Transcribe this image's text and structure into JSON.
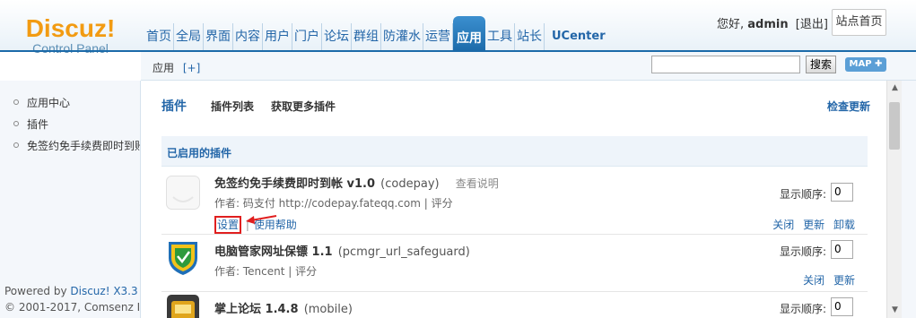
{
  "logo": {
    "main": "Discuz!",
    "sub": "Control Panel"
  },
  "nav": {
    "items": [
      "首页",
      "全局",
      "界面",
      "内容",
      "用户",
      "门户",
      "论坛",
      "群组",
      "防灌水",
      "运营",
      "应用",
      "工具",
      "站长",
      "UCenter"
    ],
    "active": "应用"
  },
  "user": {
    "greeting": "您好,",
    "name": "admin",
    "logout": "[退出]",
    "home_button": "站点首页"
  },
  "subbar": {
    "breadcrumb": "应用",
    "add": "[+]",
    "search_button": "搜索",
    "map_button": "MAP ✚"
  },
  "sidebar": {
    "items": [
      "应用中心",
      "插件",
      "免签约免手续费即时到账"
    ],
    "footer_powered": "Powered by ",
    "footer_link": "Discuz! X3.3",
    "footer_copyright": "© 2001-2017, Comsenz Inc."
  },
  "main": {
    "title": "插件",
    "tabs": [
      "插件列表",
      "获取更多插件"
    ],
    "check_update": "检查更新",
    "section_title": "已启用的插件",
    "order_label": "显示顺序:",
    "plugins": [
      {
        "name": "免签约免手续费即时到帐 v1.0",
        "identifier": "(codepay)",
        "view_doc": "查看说明",
        "meta": "作者: 码支付 http://codepay.fateqq.com | 评分",
        "settings": "设置",
        "help": "使用帮助",
        "order": "0",
        "actions": [
          "关闭",
          "更新",
          "卸载"
        ]
      },
      {
        "name": "电脑管家网址保镖 1.1",
        "identifier": "(pcmgr_url_safeguard)",
        "meta": "作者: Tencent | 评分",
        "order": "0",
        "actions": [
          "关闭",
          "更新"
        ]
      },
      {
        "name": "掌上论坛 1.4.8",
        "identifier": "(mobile)",
        "order": "0"
      }
    ]
  },
  "colors": {
    "accent": "#2366a8",
    "logo": "#f29b12",
    "highlight": "#e01f1f"
  }
}
